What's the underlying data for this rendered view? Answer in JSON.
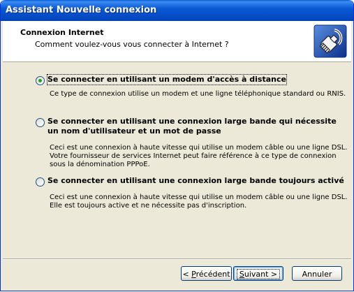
{
  "window": {
    "title": "Assistant Nouvelle connexion"
  },
  "header": {
    "title": "Connexion Internet",
    "subtitle": "Comment voulez-vous vous connecter à Internet ?",
    "icon": "network-cable-icon"
  },
  "options": [
    {
      "label_lines": [
        "Se connecter en utilisant un modem d'accès à distance"
      ],
      "description_lines": [
        "Ce type de connexion utilise un modem et une ligne téléphonique standard ou RNIS."
      ],
      "selected": true
    },
    {
      "label_lines": [
        "Se connecter en utilisant une connexion large bande qui nécessite",
        "un nom d'utilisateur et un mot de passe"
      ],
      "description_lines": [
        "Ceci est une connexion à haute vitesse qui utilise un modem câble ou une ligne DSL.",
        "Votre fournisseur de services Internet peut faire référence à ce type de connexion",
        "sous la dénomination PPPoE."
      ],
      "selected": false
    },
    {
      "label_lines": [
        "Se connecter en utilisant une connexion large bande toujours activé"
      ],
      "description_lines": [
        "Ceci est une connexion à haute vitesse qui utilise un modem câble ou une ligne DSL.",
        "Elle est toujours active et ne nécessite pas d'inscription."
      ],
      "selected": false
    }
  ],
  "buttons": {
    "back": {
      "accel": "P",
      "rest": "récédent",
      "prefix": "< "
    },
    "next": {
      "accel": "S",
      "rest": "uivant",
      "suffix": " >"
    },
    "cancel": "Annuler"
  },
  "colors": {
    "title_bar": "#0a59d4",
    "radio_dot": "#21a121",
    "dialog_bg": "#ece9d8"
  }
}
